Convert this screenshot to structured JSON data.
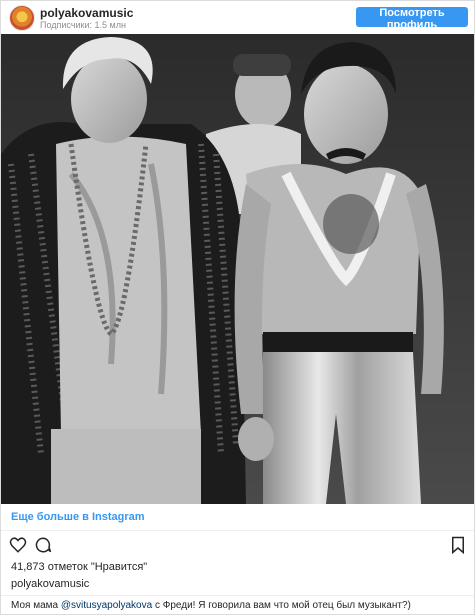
{
  "header": {
    "username": "polyakovamusic",
    "subtitle": "Подписчики: 1.5 млн",
    "follow_label": "Посмотреть профиль"
  },
  "photo": {
    "alt_description": ""
  },
  "more_link": "Еще больше в Instagram",
  "actions": {
    "icons": [
      "heart-icon",
      "comment-icon",
      "bookmark-icon"
    ]
  },
  "likes": "41,873 отметок \"Нравится\"",
  "author": "polyakovamusic",
  "caption": {
    "before": "Моя мама ",
    "mention": "@svitusyapolyakova",
    "after": " с Фреди! Я говорила вам что мой отец был музыкант?)"
  },
  "colors": {
    "accent": "#3897f0",
    "text": "#262626",
    "muted": "#8e8e8e"
  }
}
